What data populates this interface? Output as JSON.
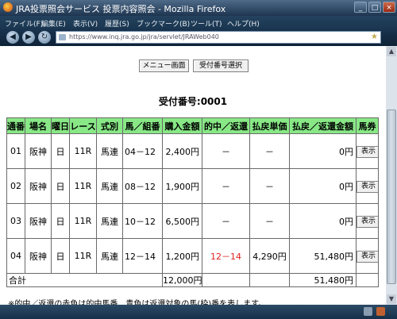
{
  "window": {
    "title": "JRA投票照会サービス  投票内容照会 - Mozilla Firefox"
  },
  "menu": [
    {
      "label": "ファイル(F)"
    },
    {
      "label": "編集(E)"
    },
    {
      "label": "表示(V)"
    },
    {
      "label": "履歴(S)"
    },
    {
      "label": "ブックマーク(B)"
    },
    {
      "label": "ツール(T)"
    },
    {
      "label": "ヘルプ(H)"
    }
  ],
  "address_bar": {
    "url": "https://www.inq.jra.go.jp/jra/servlet/JRAWeb040"
  },
  "buttons": {
    "menu": "メニュー画面",
    "receipt_select": "受付番号選択"
  },
  "receipt": "受付番号:0001",
  "table": {
    "headers": [
      "通番",
      "場名",
      "曜日",
      "レース",
      "式別",
      "馬／組番",
      "購入金額",
      "的中／返還",
      "払戻単価",
      "払戻／返還金額",
      "馬券"
    ],
    "rows": [
      {
        "no": "01",
        "venue": "阪神",
        "day": "日",
        "race": "11R",
        "type": "馬連",
        "combo": "04－12",
        "amount": "2,400円",
        "hit": "－",
        "unit": "－",
        "payout": "0円",
        "action": "表示"
      },
      {
        "no": "02",
        "venue": "阪神",
        "day": "日",
        "race": "11R",
        "type": "馬連",
        "combo": "08－12",
        "amount": "1,900円",
        "hit": "－",
        "unit": "－",
        "payout": "0円",
        "action": "表示"
      },
      {
        "no": "03",
        "venue": "阪神",
        "day": "日",
        "race": "11R",
        "type": "馬連",
        "combo": "10－12",
        "amount": "6,500円",
        "hit": "－",
        "unit": "－",
        "payout": "0円",
        "action": "表示"
      },
      {
        "no": "04",
        "venue": "阪神",
        "day": "日",
        "race": "11R",
        "type": "馬連",
        "combo": "12－14",
        "amount": "1,200円",
        "hit": "12－14",
        "unit": "4,290円",
        "payout": "51,480円",
        "action": "表示"
      }
    ],
    "total": {
      "label": "合計",
      "amount": "12,000円",
      "payout": "51,480円"
    }
  },
  "footnote": "※的中／返還の赤色は的中馬番、青色は返還対象の馬(枠)番を表します。",
  "colors": {
    "header_bg": "#88e886",
    "hit_text": "#e02020"
  }
}
